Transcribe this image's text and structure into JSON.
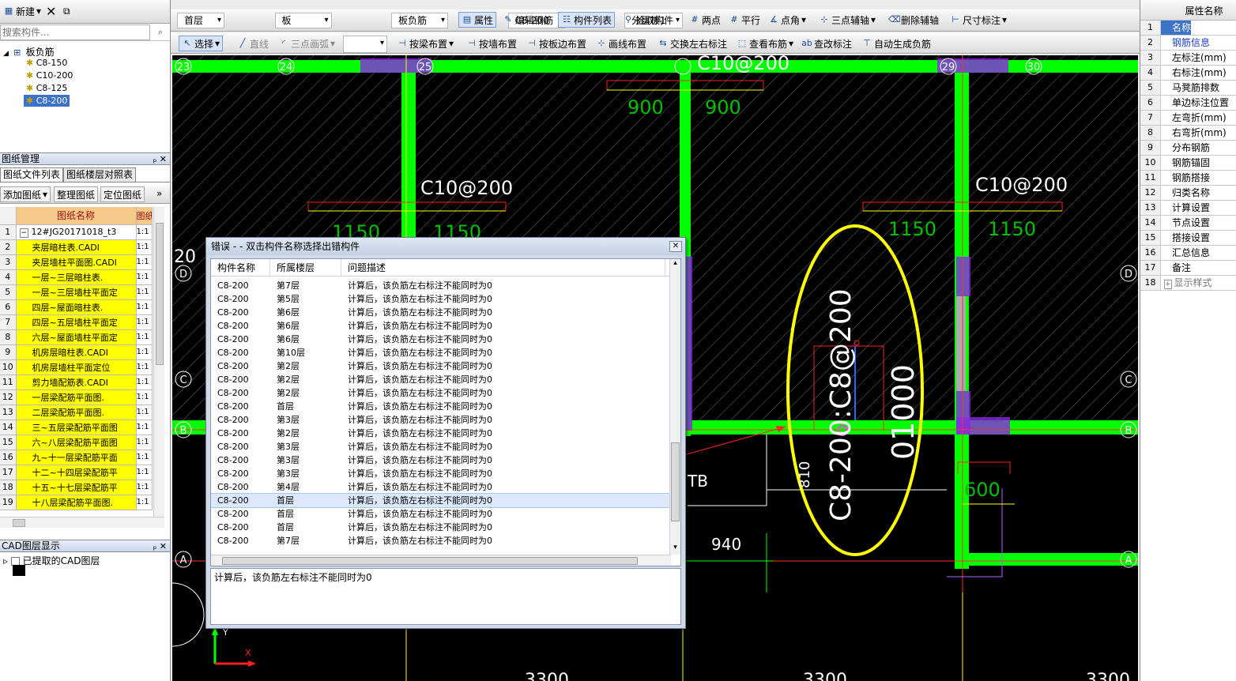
{
  "left_panel": {
    "toolbar": {
      "new_label": "新建",
      "search_placeholder": "搜索构件..."
    },
    "tree": {
      "root": "板负筋",
      "items": [
        "C8-150",
        "C10-200",
        "C8-125",
        "C8-200"
      ]
    },
    "drawing_mgmt": {
      "title": "图纸管理",
      "tabs": [
        "图纸文件列表",
        "图纸楼层对照表"
      ],
      "buttons": [
        "添加图纸",
        "整理图纸",
        "定位图纸"
      ],
      "columns": [
        "图纸名称",
        "图纸"
      ],
      "rows": [
        {
          "no": "1",
          "name": "12#JG20171018_t3",
          "scale": "1:1"
        },
        {
          "no": "2",
          "name": "夹层暗柱表.CADI",
          "scale": "1:1"
        },
        {
          "no": "3",
          "name": "夹层墙柱平面图.CADI",
          "scale": "1:1"
        },
        {
          "no": "4",
          "name": "一层~三层暗柱表.",
          "scale": "1:1"
        },
        {
          "no": "5",
          "name": "一层~三层墙柱平面定",
          "scale": "1:1"
        },
        {
          "no": "6",
          "name": "四层~屋面暗柱表.",
          "scale": "1:1"
        },
        {
          "no": "7",
          "name": "四层~五层墙柱平面定",
          "scale": "1:1"
        },
        {
          "no": "8",
          "name": "六层~屋面墙柱平面定",
          "scale": "1:1"
        },
        {
          "no": "9",
          "name": "机房层暗柱表.CADI",
          "scale": "1:1"
        },
        {
          "no": "10",
          "name": "机房层墙柱平面定位",
          "scale": "1:1"
        },
        {
          "no": "11",
          "name": "剪力墙配筋表.CADI",
          "scale": "1:1"
        },
        {
          "no": "12",
          "name": "一层梁配筋平面图.",
          "scale": "1:1"
        },
        {
          "no": "13",
          "name": "二层梁配筋平面图.",
          "scale": "1:1"
        },
        {
          "no": "14",
          "name": "三~五层梁配筋平面图",
          "scale": "1:1"
        },
        {
          "no": "15",
          "name": "六~八层梁配筋平面图",
          "scale": "1:1"
        },
        {
          "no": "16",
          "name": "九~十一层梁配筋平面",
          "scale": "1:1"
        },
        {
          "no": "17",
          "name": "十二~十四层梁配筋平",
          "scale": "1:1"
        },
        {
          "no": "18",
          "name": "十五~十七层梁配筋平",
          "scale": "1:1"
        },
        {
          "no": "19",
          "name": "十八层梁配筋平面图.",
          "scale": "1:1"
        }
      ]
    },
    "cad_layers": {
      "title": "CAD图层显示",
      "item": "已提取的CAD图层"
    }
  },
  "toolbar1": {
    "floor": "首层",
    "type": "板",
    "subtype": "板负筋",
    "component": "C8-200",
    "layer": "分层板1",
    "buttons": [
      "属性",
      "编辑钢筋",
      "构件列表",
      "拾取构件",
      "两点",
      "平行",
      "点角",
      "三点辅轴",
      "删除辅轴",
      "尺寸标注"
    ]
  },
  "toolbar2": {
    "buttons": [
      "选择",
      "直线",
      "三点画弧",
      "按梁布置",
      "按墙布置",
      "按板边布置",
      "画线布置",
      "交换左右标注",
      "查看布筋",
      "查改标注",
      "自动生成负筋"
    ]
  },
  "canvas": {
    "labels": [
      "C10@200",
      "900",
      "900",
      "C10@200",
      "1150",
      "1150",
      "C10@200",
      "1150",
      "1150",
      "C8-200:C8@200",
      "01000",
      "810",
      "TB",
      "940",
      "600",
      "20",
      "3300",
      "3300",
      "3300"
    ],
    "axis_labels": [
      "23",
      "24",
      "25",
      "29",
      "30",
      "D",
      "C",
      "B",
      "A",
      "D",
      "C",
      "B",
      "A"
    ],
    "ucs": {
      "x": "X",
      "y": "Y"
    }
  },
  "dialog": {
    "title": "错误 - - 双击构件名称选择出错构件",
    "columns": [
      "构件名称",
      "所属楼层",
      "问题描述"
    ],
    "rows": [
      {
        "name": "C8-200",
        "floor": "第7层",
        "desc": "计算后，该负筋左右标注不能同时为0"
      },
      {
        "name": "C8-200",
        "floor": "第5层",
        "desc": "计算后，该负筋左右标注不能同时为0"
      },
      {
        "name": "C8-200",
        "floor": "第6层",
        "desc": "计算后，该负筋左右标注不能同时为0"
      },
      {
        "name": "C8-200",
        "floor": "第6层",
        "desc": "计算后，该负筋左右标注不能同时为0"
      },
      {
        "name": "C8-200",
        "floor": "第6层",
        "desc": "计算后，该负筋左右标注不能同时为0"
      },
      {
        "name": "C8-200",
        "floor": "第10层",
        "desc": "计算后，该负筋左右标注不能同时为0"
      },
      {
        "name": "C8-200",
        "floor": "第2层",
        "desc": "计算后，该负筋左右标注不能同时为0"
      },
      {
        "name": "C8-200",
        "floor": "第2层",
        "desc": "计算后，该负筋左右标注不能同时为0"
      },
      {
        "name": "C8-200",
        "floor": "第2层",
        "desc": "计算后，该负筋左右标注不能同时为0"
      },
      {
        "name": "C8-200",
        "floor": "首层",
        "desc": "计算后，该负筋左右标注不能同时为0"
      },
      {
        "name": "C8-200",
        "floor": "第3层",
        "desc": "计算后，该负筋左右标注不能同时为0"
      },
      {
        "name": "C8-200",
        "floor": "第2层",
        "desc": "计算后，该负筋左右标注不能同时为0"
      },
      {
        "name": "C8-200",
        "floor": "第3层",
        "desc": "计算后，该负筋左右标注不能同时为0"
      },
      {
        "name": "C8-200",
        "floor": "第3层",
        "desc": "计算后，该负筋左右标注不能同时为0"
      },
      {
        "name": "C8-200",
        "floor": "第3层",
        "desc": "计算后，该负筋左右标注不能同时为0"
      },
      {
        "name": "C8-200",
        "floor": "第4层",
        "desc": "计算后，该负筋左右标注不能同时为0"
      },
      {
        "name": "C8-200",
        "floor": "首层",
        "desc": "计算后，该负筋左右标注不能同时为0"
      },
      {
        "name": "C8-200",
        "floor": "首层",
        "desc": "计算后，该负筋左右标注不能同时为0"
      },
      {
        "name": "C8-200",
        "floor": "首层",
        "desc": "计算后，该负筋左右标注不能同时为0"
      },
      {
        "name": "C8-200",
        "floor": "第7层",
        "desc": "计算后，该负筋左右标注不能同时为0"
      }
    ],
    "selected_index": 16,
    "description": "计算后，该负筋左右标注不能同时为0"
  },
  "properties": {
    "header": "属性名称",
    "rows": [
      "名称",
      "钢筋信息",
      "左标注(mm)",
      "右标注(mm)",
      "马凳筋排数",
      "单边标注位置",
      "左弯折(mm)",
      "右弯折(mm)",
      "分布钢筋",
      "钢筋锚固",
      "钢筋搭接",
      "归类名称",
      "计算设置",
      "节点设置",
      "搭接设置",
      "汇总信息",
      "备注",
      "显示样式"
    ]
  },
  "colors": {
    "accent": "#3b73c8",
    "grid_yellow": "#ffff00",
    "beam_green": "#00ff00",
    "annotation_yellow": "#ffff00"
  }
}
